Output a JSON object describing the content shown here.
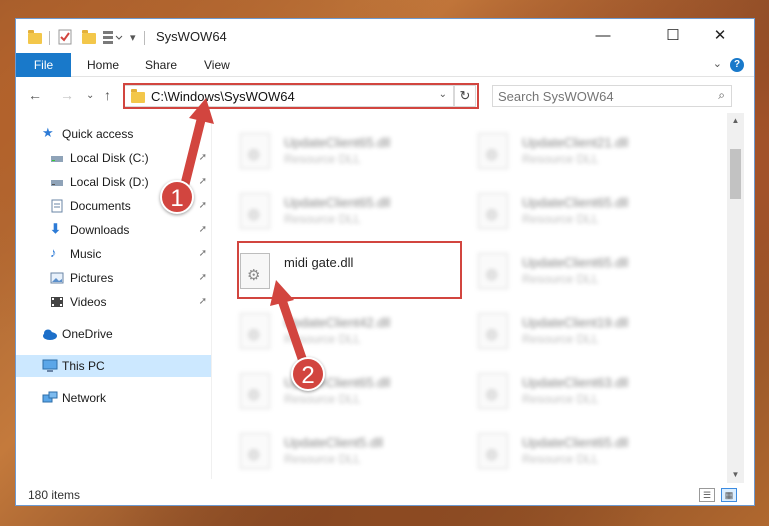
{
  "window": {
    "title": "SysWOW64",
    "controls": {
      "minimize": "—",
      "maximize": "☐",
      "close": "✕"
    }
  },
  "ribbon": {
    "tabs": [
      "File",
      "Home",
      "Share",
      "View"
    ],
    "expand_glyph": "⌄",
    "help_glyph": "?"
  },
  "nav": {
    "back": "←",
    "forward": "→",
    "recent": "⌄",
    "up": "↑",
    "address_path": "C:\\Windows\\SysWOW64",
    "refresh": "↻",
    "search_placeholder": "Search SysWOW64"
  },
  "sidebar": {
    "items": [
      {
        "label": "Quick access",
        "icon": "star-icon",
        "pinned": false
      },
      {
        "label": "Local Disk (C:)",
        "icon": "drive-icon",
        "pinned": true
      },
      {
        "label": "Local Disk (D:)",
        "icon": "drive-icon",
        "pinned": true
      },
      {
        "label": "Documents",
        "icon": "document-icon",
        "pinned": true
      },
      {
        "label": "Downloads",
        "icon": "download-icon",
        "pinned": true
      },
      {
        "label": "Music",
        "icon": "music-icon",
        "pinned": true
      },
      {
        "label": "Pictures",
        "icon": "pictures-icon",
        "pinned": true
      },
      {
        "label": "Videos",
        "icon": "video-icon",
        "pinned": true
      },
      {
        "label": "OneDrive",
        "icon": "cloud-icon",
        "pinned": false
      },
      {
        "label": "This PC",
        "icon": "computer-icon",
        "pinned": false,
        "selected": true
      },
      {
        "label": "Network",
        "icon": "network-icon",
        "pinned": false
      }
    ],
    "pin_glyph": "📌"
  },
  "files": {
    "left": [
      {
        "name": "UpdateClient65.dll",
        "type": "Resource DLL",
        "blurred": true
      },
      {
        "name": "UpdateClient65.dll",
        "type": "Resource DLL",
        "blurred": true
      },
      {
        "name": "midi gate.dll",
        "type": "",
        "blurred": false
      },
      {
        "name": "UpdateClient42.dll",
        "type": "Resource DLL",
        "blurred": true
      },
      {
        "name": "UpdateClient65.dll",
        "type": "Resource DLL",
        "blurred": true
      },
      {
        "name": "UpdateClient5.dll",
        "type": "Resource DLL",
        "blurred": true
      }
    ],
    "right": [
      {
        "name": "UpdateClient21.dll",
        "type": "Resource DLL",
        "blurred": true
      },
      {
        "name": "UpdateClient65.dll",
        "type": "Resource DLL",
        "blurred": true
      },
      {
        "name": "UpdateClient65.dll",
        "type": "Resource DLL",
        "blurred": true
      },
      {
        "name": "UpdateClient19.dll",
        "type": "Resource DLL",
        "blurred": true
      },
      {
        "name": "UpdateClient63.dll",
        "type": "Resource DLL",
        "blurred": true
      },
      {
        "name": "UpdateClient65.dll",
        "type": "Resource DLL",
        "blurred": true
      }
    ]
  },
  "status": {
    "item_count": "180 items"
  },
  "callouts": [
    "1",
    "2"
  ],
  "colors": {
    "accent": "#1979ca",
    "highlight": "#d2453f",
    "selected": "#cce8ff"
  }
}
